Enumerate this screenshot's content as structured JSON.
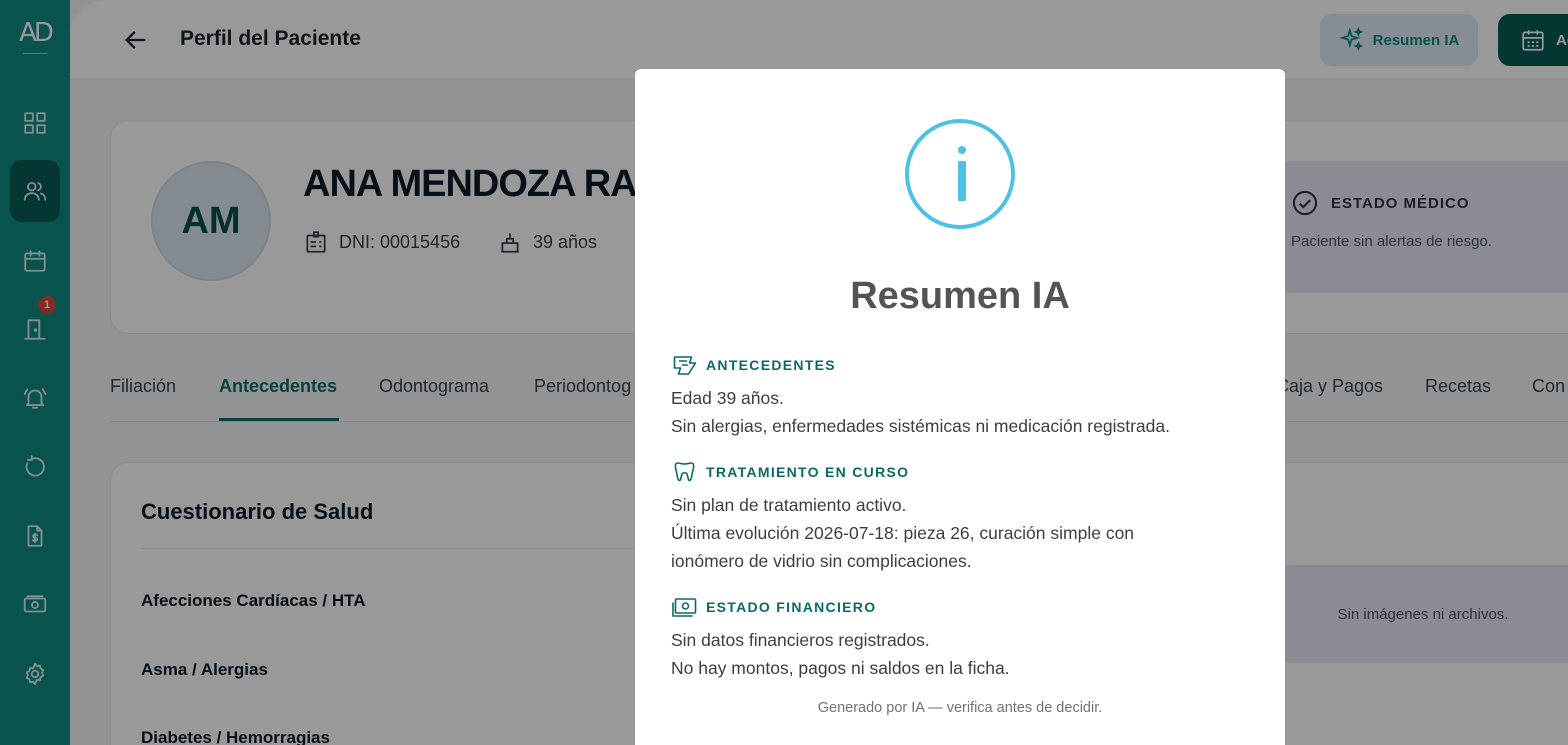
{
  "sidebar": {
    "logo": "AD",
    "items": [
      {
        "icon": "dashboard-icon"
      },
      {
        "icon": "patients-icon",
        "active": true
      },
      {
        "icon": "calendar-icon"
      },
      {
        "icon": "waiting-room-icon",
        "badge": "1"
      },
      {
        "icon": "bell-icon"
      },
      {
        "icon": "history-icon"
      },
      {
        "icon": "invoice-icon"
      },
      {
        "icon": "cash-icon"
      },
      {
        "icon": "settings-icon"
      }
    ]
  },
  "header": {
    "title": "Perfil del Paciente",
    "resumen_button": "Resumen IA",
    "agenda_button": "Ag"
  },
  "patient": {
    "initials": "AM",
    "name": "ANA MENDOZA RA",
    "dni": "DNI: 00015456",
    "age": "39 años",
    "status_title": "ESTADO MÉDICO",
    "status_text": "Paciente sin alertas de riesgo."
  },
  "tabs": [
    {
      "label": "Filiación"
    },
    {
      "label": "Antecedentes",
      "active": true
    },
    {
      "label": "Odontograma"
    },
    {
      "label": "Periodontog"
    },
    {
      "label": "Caja y Pagos"
    },
    {
      "label": "Recetas"
    },
    {
      "label": "Con"
    }
  ],
  "questionnaire": {
    "title": "Cuestionario de Salud",
    "rows": [
      "Afecciones Cardíacas / HTA",
      "Asma / Alergias",
      "Diabetes / Hemorragias"
    ],
    "files_empty": "Sin imágenes ni archivos."
  },
  "modal": {
    "title": "Resumen IA",
    "sections": [
      {
        "icon": "clipboard-history-icon",
        "heading": "ANTECEDENTES",
        "lines": [
          "Edad 39 años.",
          "Sin alergias, enfermedades sistémicas ni medicación registrada."
        ]
      },
      {
        "icon": "tooth-icon",
        "heading": "TRATAMIENTO EN CURSO",
        "lines": [
          "Sin plan de tratamiento activo.",
          "Última evolución 2026-07-18: pieza 26, curación simple con",
          "ionómero de vidrio sin complicaciones."
        ]
      },
      {
        "icon": "money-icon",
        "heading": "ESTADO FINANCIERO",
        "lines": [
          "Sin datos financieros registrados.",
          "No hay montos, pagos ni saldos en la ficha."
        ]
      }
    ],
    "footer": "Generado por IA — verifica antes de decidir."
  },
  "colors": {
    "sidebar": "#0e8a80",
    "accent_dark": "#075a54",
    "info_icon": "#4fc1e5"
  }
}
